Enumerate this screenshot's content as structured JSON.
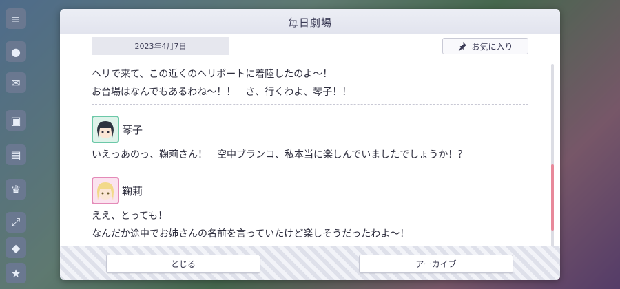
{
  "modal": {
    "title": "毎日劇場",
    "date": "2023年4月7日",
    "favorite_label": "お気に入り"
  },
  "dialogue": {
    "first_block": [
      "ヘリで来て、この近くのヘリポートに着陸したのよ〜！",
      "お台場はなんでもあるわね〜！！　さ、行くわよ、琴子！！"
    ],
    "entries": [
      {
        "speaker": "琴子",
        "lines": [
          "いえっあのっ、鞠莉さん！　空中ブランコ、私本当に楽しんでいましたでしょうか！？"
        ]
      },
      {
        "speaker": "鞠莉",
        "lines": [
          "ええ、とっても！",
          "なんだか途中でお姉さんの名前を言っていたけど楽しそうだったわよ〜！"
        ]
      }
    ]
  },
  "footer": {
    "close_label": "とじる",
    "archive_label": "アーカイブ"
  },
  "scroll": {
    "position_fraction": 0.55
  },
  "colors": {
    "accent_scroll": "#e8899a",
    "koto_frame": "#6cc8a8",
    "mari_frame": "#e48ab8"
  }
}
